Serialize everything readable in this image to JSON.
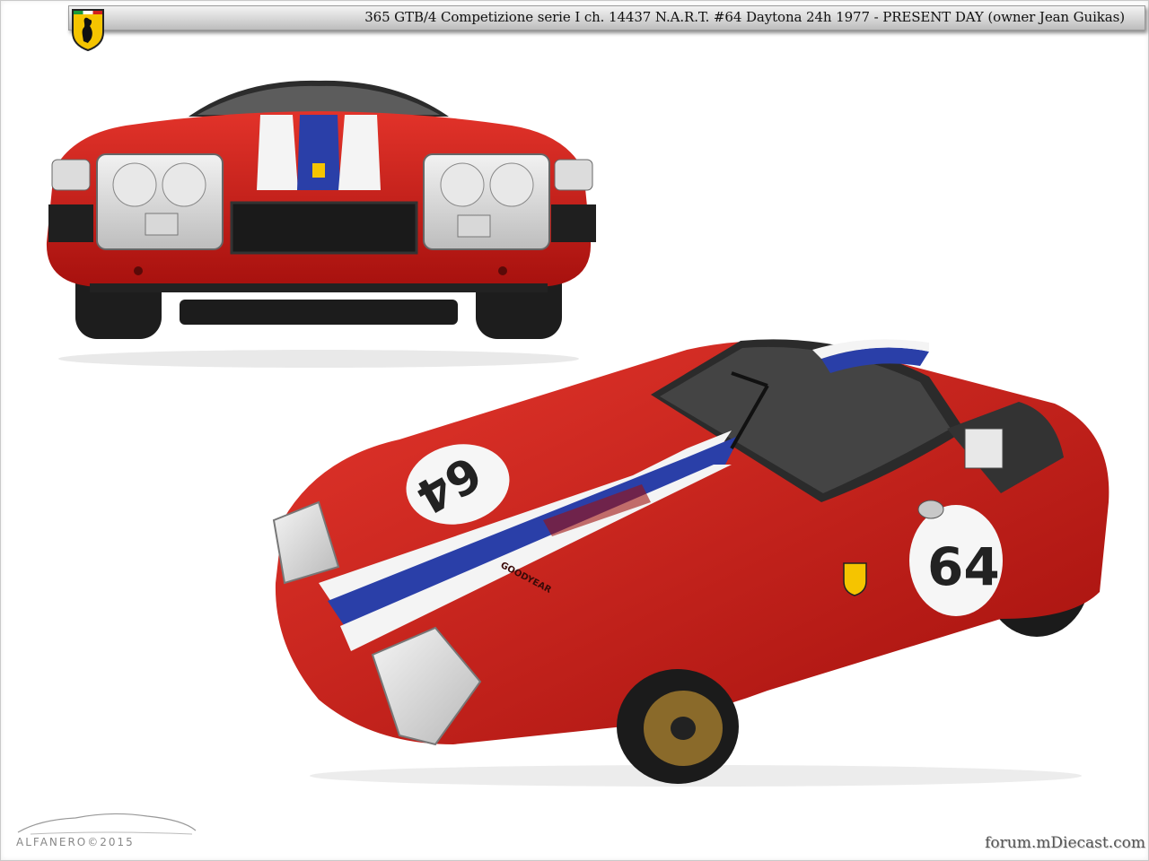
{
  "header": {
    "title": "365 GTB/4 Competizione serie I  ch. 14437 N.A.R.T.  #64  Daytona 24h 1977 - PRESENT DAY (owner Jean Guikas)"
  },
  "car": {
    "race_number": "64",
    "tire_brand": "GOODYEAR",
    "body_color": "#d2211c",
    "stripe_white": "#f4f4f4",
    "stripe_blue": "#2a3fa8"
  },
  "footer": {
    "left_logo": "ALFANERO©2015",
    "right_logo": "forum.mDiecast.com"
  },
  "icons": {
    "shield": "ferrari-shield-icon"
  }
}
